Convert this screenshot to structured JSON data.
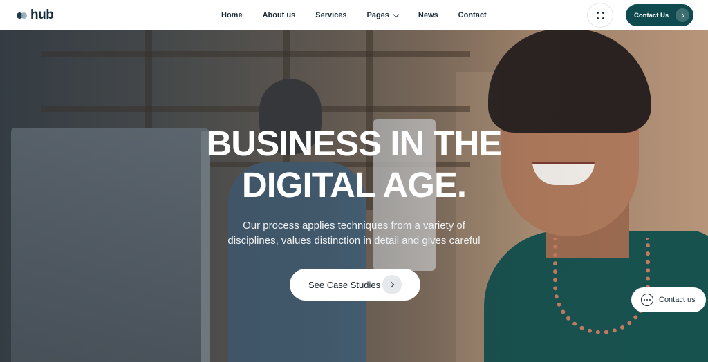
{
  "header": {
    "logo_text": "hub",
    "nav": [
      {
        "label": "Home"
      },
      {
        "label": "About us"
      },
      {
        "label": "Services"
      },
      {
        "label": "Pages",
        "has_dropdown": true
      },
      {
        "label": "News"
      },
      {
        "label": "Contact"
      }
    ],
    "contact_button_label": "Contact Us"
  },
  "hero": {
    "title_line1": "BUSINESS IN THE",
    "title_line2": "DIGITAL AGE.",
    "subtitle_line1": "Our process applies techniques from a variety of",
    "subtitle_line2": "disciplines, values distinction in detail and gives careful",
    "cta_label": "See Case Studies"
  },
  "chat": {
    "label": "Contact us"
  },
  "colors": {
    "brand_dark": "#0f4a4f",
    "text_dark": "#1b2c38",
    "white": "#ffffff"
  }
}
